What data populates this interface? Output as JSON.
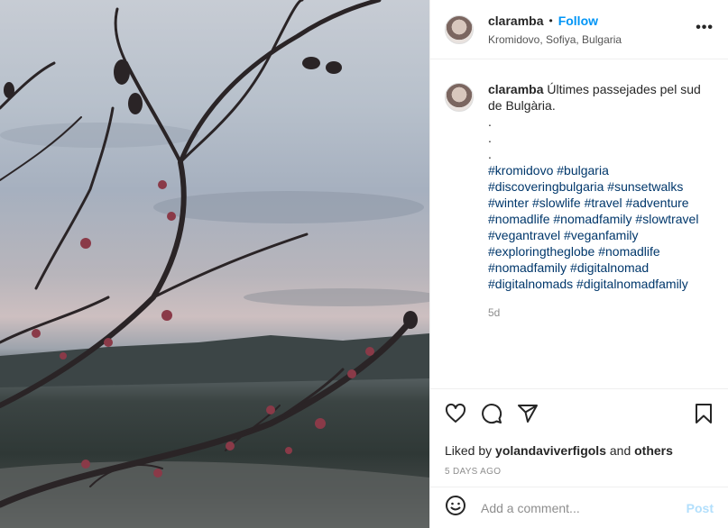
{
  "post": {
    "username": "claramba",
    "follow_label": "Follow",
    "separator": "•",
    "location": "Kromidovo, Sofiya, Bulgaria",
    "more_icon": "more-horizontal-icon",
    "more_label": "•••"
  },
  "caption": {
    "username": "claramba",
    "text": "Últimes passejades pel sud de Bulgària.",
    "dots": [
      ".",
      ".",
      "."
    ],
    "hashtag_lines": [
      "#kromidovo #bulgaria",
      "#discoveringbulgaria #sunsetwalks",
      "#winter #slowlife #travel #adventure",
      "#nomadlife #nomadfamily #slowtravel",
      "#vegantravel #veganfamily",
      "#exploringtheglobe #nomadlife",
      "#nomadfamily #digitalnomad",
      "#digitalnomads #digitalnomadfamily"
    ],
    "time_ago": "5d"
  },
  "actions": {
    "icons": [
      "heart-icon",
      "comment-icon",
      "share-icon",
      "bookmark-icon"
    ],
    "liked_by_prefix": "Liked by",
    "liked_by_user": "yolandaviverfigols",
    "liked_by_and": "and",
    "liked_by_others": "others",
    "date": "5 DAYS AGO"
  },
  "comment": {
    "placeholder": "Add a comment...",
    "post_label": "Post",
    "emoji_icon": "emoji-icon"
  },
  "colors": {
    "link_blue": "#0095f6",
    "hashtag": "#00376b",
    "post_disabled": "#b2dffc"
  }
}
